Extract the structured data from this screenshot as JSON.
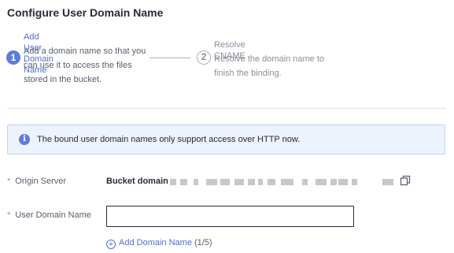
{
  "page": {
    "title": "Configure User Domain Name"
  },
  "steps": [
    {
      "number": "1",
      "title": "Add User Domain Name",
      "description": "Add a domain name so that you can use it to access the files stored in the bucket.",
      "state": "active"
    },
    {
      "number": "2",
      "title": "Resolve CNAME",
      "description": "Resolve the domain name to finish the binding.",
      "state": "pending"
    }
  ],
  "notice": {
    "icon": "info-icon",
    "text": "The bound user domain names only support access over HTTP now."
  },
  "form": {
    "origin_server": {
      "required_mark": "*",
      "label": "Origin Server",
      "bucket_label": "Bucket domain",
      "bucket_value_masked": true
    },
    "user_domain": {
      "required_mark": "*",
      "label": "User Domain Name",
      "value": "",
      "placeholder": ""
    },
    "add_domain": {
      "label": "Add Domain Name",
      "count": "(1/5)"
    }
  },
  "colors": {
    "accent": "#5e7ce0",
    "link": "#526ecc",
    "required": "#f66f6a",
    "notice_bg": "#edf3fd"
  }
}
